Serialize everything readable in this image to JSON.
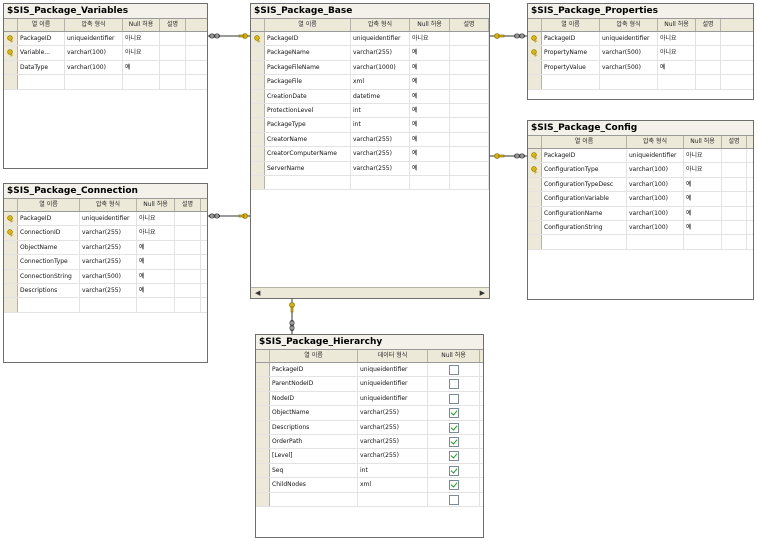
{
  "columns": {
    "col_name": "열 이름",
    "data_type_cond": "압축 형식",
    "data_type": "데이터 형식",
    "allow_null": "Null 허용",
    "desc": "설명"
  },
  "tables": {
    "variables": {
      "title": "$SIS_Package_Variables",
      "rows": [
        {
          "name": "PackageID",
          "type": "uniqueidentifier",
          "null": "아니요",
          "key": true
        },
        {
          "name": "Variable...",
          "type": "varchar(100)",
          "null": "아니요",
          "key": true
        },
        {
          "name": "DataType",
          "type": "varchar(100)",
          "null": "예",
          "key": false
        }
      ]
    },
    "base": {
      "title": "$SIS_Package_Base",
      "rows": [
        {
          "name": "PackageID",
          "type": "uniqueidentifier",
          "null": "아니요",
          "key": true
        },
        {
          "name": "PackageName",
          "type": "varchar(255)",
          "null": "예",
          "key": false
        },
        {
          "name": "PackageFileName",
          "type": "varchar(1000)",
          "null": "예",
          "key": false
        },
        {
          "name": "PackageFile",
          "type": "xml",
          "null": "예",
          "key": false
        },
        {
          "name": "CreationDate",
          "type": "datetime",
          "null": "예",
          "key": false
        },
        {
          "name": "ProtectionLevel",
          "type": "int",
          "null": "예",
          "key": false
        },
        {
          "name": "PackageType",
          "type": "int",
          "null": "예",
          "key": false
        },
        {
          "name": "CreatorName",
          "type": "varchar(255)",
          "null": "예",
          "key": false
        },
        {
          "name": "CreatorComputerName",
          "type": "varchar(255)",
          "null": "예",
          "key": false
        },
        {
          "name": "ServerName",
          "type": "varchar(255)",
          "null": "예",
          "key": false
        }
      ]
    },
    "properties": {
      "title": "$SIS_Package_Properties",
      "rows": [
        {
          "name": "PackageID",
          "type": "uniqueidentifier",
          "null": "아니요",
          "key": true
        },
        {
          "name": "PropertyName",
          "type": "varchar(500)",
          "null": "아니요",
          "key": true
        },
        {
          "name": "PropertyValue",
          "type": "varchar(500)",
          "null": "예",
          "key": false
        }
      ]
    },
    "config": {
      "title": "$SIS_Package_Config",
      "rows": [
        {
          "name": "PackageID",
          "type": "uniqueidentifier",
          "null": "아니요",
          "key": true
        },
        {
          "name": "ConfigurationType",
          "type": "varchar(100)",
          "null": "아니요",
          "key": true
        },
        {
          "name": "ConfigurationTypeDesc",
          "type": "varchar(100)",
          "null": "예",
          "key": false
        },
        {
          "name": "ConfigurationVariable",
          "type": "varchar(100)",
          "null": "예",
          "key": false
        },
        {
          "name": "ConfigurationName",
          "type": "varchar(100)",
          "null": "예",
          "key": false
        },
        {
          "name": "ConfigurationString",
          "type": "varchar(100)",
          "null": "예",
          "key": false
        }
      ]
    },
    "connection": {
      "title": "$SIS_Package_Connection",
      "rows": [
        {
          "name": "PackageID",
          "type": "uniqueidentifier",
          "null": "아니요",
          "key": true
        },
        {
          "name": "ConnectionID",
          "type": "varchar(255)",
          "null": "아니요",
          "key": true
        },
        {
          "name": "ObjectName",
          "type": "varchar(255)",
          "null": "예",
          "key": false
        },
        {
          "name": "ConnectionType",
          "type": "varchar(255)",
          "null": "예",
          "key": false
        },
        {
          "name": "ConnectionString",
          "type": "varchar(500)",
          "null": "예",
          "key": false
        },
        {
          "name": "Descriptions",
          "type": "varchar(255)",
          "null": "예",
          "key": false
        }
      ]
    },
    "hierarchy": {
      "title": "$SIS_Package_Hierarchy",
      "rows": [
        {
          "name": "PackageID",
          "type": "uniqueidentifier",
          "checked": false
        },
        {
          "name": "ParentNodeID",
          "type": "uniqueidentifier",
          "checked": false
        },
        {
          "name": "NodeID",
          "type": "uniqueidentifier",
          "checked": false
        },
        {
          "name": "ObjectName",
          "type": "varchar(255)",
          "checked": true
        },
        {
          "name": "Descriptions",
          "type": "varchar(255)",
          "checked": true
        },
        {
          "name": "OrderPath",
          "type": "varchar(255)",
          "checked": true
        },
        {
          "name": "[Level]",
          "type": "varchar(255)",
          "checked": true
        },
        {
          "name": "Seq",
          "type": "int",
          "checked": true
        },
        {
          "name": "ChildNodes",
          "type": "xml",
          "checked": true
        }
      ]
    }
  }
}
